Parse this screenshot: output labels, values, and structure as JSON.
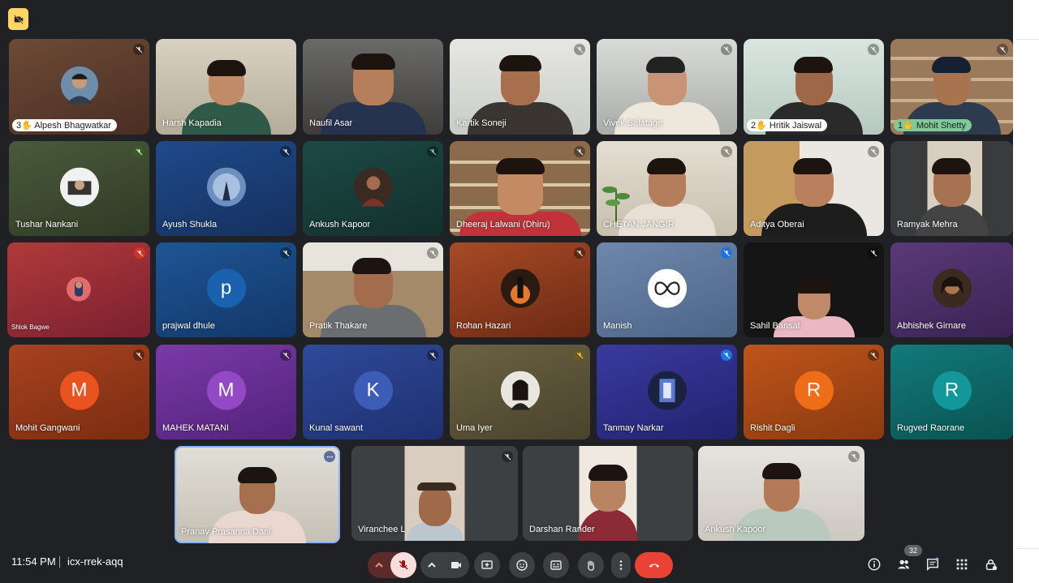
{
  "meeting": {
    "time": "11:54 PM",
    "code": "icx-rrek-aqq",
    "participant_count": "32"
  },
  "tiles": [
    {
      "name": "Alpesh Bhagwatkar",
      "badge": "3",
      "style": "pill"
    },
    {
      "name": "Harsh Kapadia"
    },
    {
      "name": "Naufil Asar"
    },
    {
      "name": "Kartik Soneji"
    },
    {
      "name": "Vivek Salatage"
    },
    {
      "name": "Hritik Jaiswal",
      "badge": "2",
      "style": "pill"
    },
    {
      "name": "Mohit Shetty",
      "badge": "1",
      "style": "pill-green"
    },
    {
      "name": "Tushar Nankani"
    },
    {
      "name": "Ayush Shukla"
    },
    {
      "name": "Ankush Kapoor"
    },
    {
      "name": "Dheeraj Lalwani (Dhiru)"
    },
    {
      "name": "CHETAN JANGIR"
    },
    {
      "name": "Aditya Oberai"
    },
    {
      "name": "Ramyak Mehra"
    },
    {
      "name": "Shlok Bagwe"
    },
    {
      "name": "prajwal dhule",
      "initial": "p"
    },
    {
      "name": "Pratik Thakare"
    },
    {
      "name": "Rohan Hazari"
    },
    {
      "name": "Manish"
    },
    {
      "name": "Sahil Bansal"
    },
    {
      "name": "Abhishek Girnare"
    },
    {
      "name": "Mohit Gangwani",
      "initial": "M"
    },
    {
      "name": "MAHEK MATANI",
      "initial": "M"
    },
    {
      "name": "Kunal sawant",
      "initial": "K"
    },
    {
      "name": "Uma Iyer"
    },
    {
      "name": "Tanmay Narkar"
    },
    {
      "name": "Rishit Dagli",
      "initial": "R"
    },
    {
      "name": "Rugved Raorane",
      "initial": "R"
    },
    {
      "name": "Pranav Prasanna Dani"
    },
    {
      "name": "Viranchee L"
    },
    {
      "name": "Darshan Rander"
    },
    {
      "name": "Ankush Kapoor"
    }
  ],
  "icons": {
    "mic": "mic-off-icon",
    "camera": "videocam-icon",
    "present": "present-screen-icon",
    "emoji": "emoji-icon",
    "captions": "captions-icon",
    "hand": "raise-hand-icon",
    "more": "more-options-icon",
    "end": "end-call-icon",
    "info": "info-icon",
    "people": "people-icon",
    "chat": "chat-icon",
    "activities": "activities-icon",
    "host": "host-controls-icon"
  },
  "colors": {
    "background": "#202124",
    "end_call": "#ea4335",
    "mic_muted": "#f9dedc",
    "muted_badge": "#1a73e8"
  }
}
